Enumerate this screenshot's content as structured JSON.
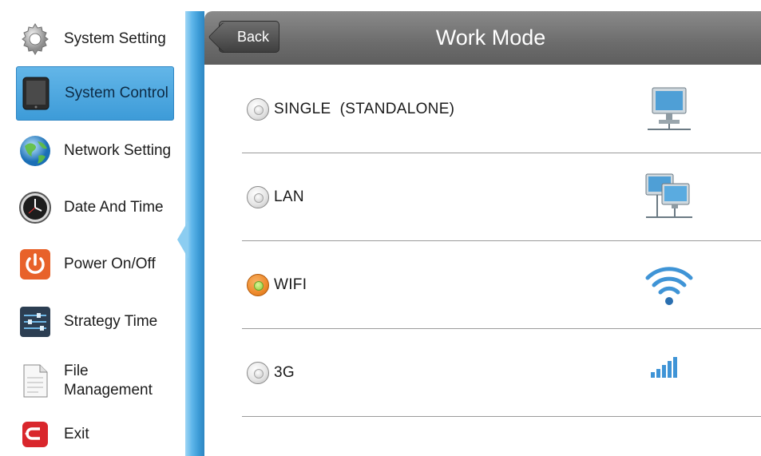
{
  "sidebar": {
    "items": [
      {
        "label": "System Setting",
        "icon": "gear-icon",
        "active": false
      },
      {
        "label": "System Control",
        "icon": "tablet-icon",
        "active": true
      },
      {
        "label": "Network Setting",
        "icon": "globe-icon",
        "active": false
      },
      {
        "label": "Date And Time",
        "icon": "clock-icon",
        "active": false
      },
      {
        "label": "Power On/Off",
        "icon": "power-icon",
        "active": false
      },
      {
        "label": "Strategy Time",
        "icon": "sliders-icon",
        "active": false
      },
      {
        "label": "File\nManagement",
        "icon": "document-icon",
        "active": false
      },
      {
        "label": "Exit",
        "icon": "exit-icon",
        "active": false
      }
    ]
  },
  "header": {
    "back_label": "Back",
    "title": "Work Mode"
  },
  "options": [
    {
      "label": "SINGLE  (STANDALONE)",
      "icon": "computer-icon",
      "selected": false
    },
    {
      "label": "LAN",
      "icon": "network-computers-icon",
      "selected": false
    },
    {
      "label": "WIFI",
      "icon": "wifi-icon",
      "selected": true
    },
    {
      "label": "3G",
      "icon": "signal-bars-icon",
      "selected": false
    }
  ],
  "colors": {
    "accent_blue": "#3d9bd8",
    "header_gray": "#6c6c6c",
    "selected_radio": "#ee8a2c"
  }
}
